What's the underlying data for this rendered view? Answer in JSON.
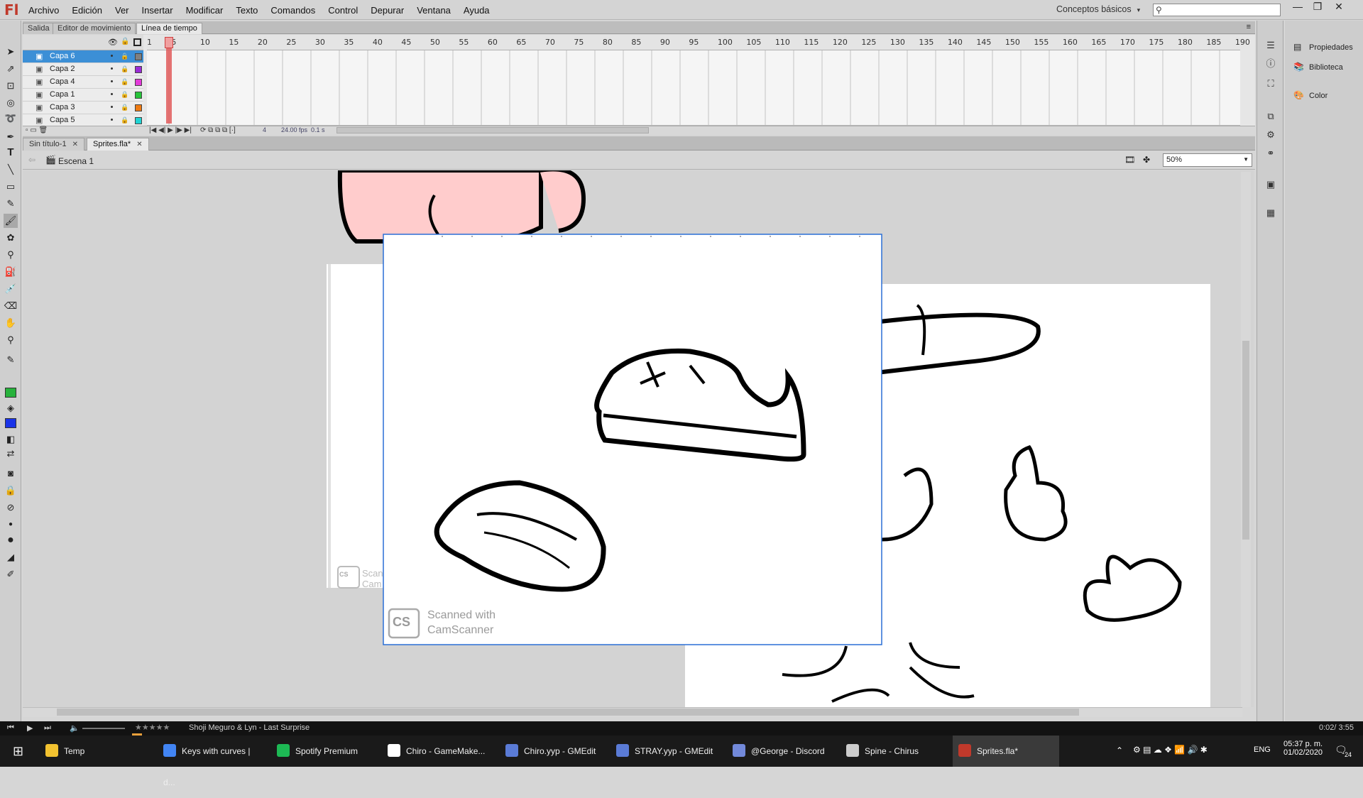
{
  "app": {
    "logo": "Fl"
  },
  "menu": [
    "Archivo",
    "Edición",
    "Ver",
    "Insertar",
    "Modificar",
    "Texto",
    "Comandos",
    "Control",
    "Depurar",
    "Ventana",
    "Ayuda"
  ],
  "workspace": {
    "label": "Conceptos básicos",
    "arrow": "▾"
  },
  "search": {
    "placeholder": ""
  },
  "window_controls": [
    "—",
    "❐",
    "✕"
  ],
  "panel_tabs": [
    "Salida",
    "Editor de movimiento",
    "Línea de tiempo"
  ],
  "timeline": {
    "layers": [
      "Capa 6",
      "Capa 2",
      "Capa 4",
      "Capa 1",
      "Capa 3",
      "Capa 5"
    ],
    "layer_colors": [
      "#808080",
      "#9b2bd6",
      "#e23ad8",
      "#27c43a",
      "#ee7a12",
      "#20d3d3"
    ],
    "ruler_ticks": [
      "1",
      "5",
      "10",
      "15",
      "20",
      "25",
      "30",
      "35",
      "40",
      "45",
      "50",
      "55",
      "60",
      "65",
      "70",
      "75",
      "80",
      "85",
      "90",
      "95",
      "100",
      "105",
      "110",
      "115",
      "120",
      "125",
      "130",
      "135",
      "140",
      "145",
      "150",
      "155",
      "160",
      "165",
      "170",
      "175",
      "180",
      "185",
      "190"
    ],
    "current_frame": "4",
    "fps": "24.00",
    "fps_unit": "fps",
    "time": "0.1 s"
  },
  "doc_tabs": [
    "Sin título-1",
    "Sprites.fla*"
  ],
  "scene": {
    "label": "Escena 1",
    "zoom": "50%"
  },
  "stage": {
    "watermark_line1": "Scanned with",
    "watermark_line2": "CamScanner",
    "watermark_short1": "Scan",
    "watermark_short2": "Cam",
    "cs": "CS"
  },
  "right_panel": {
    "items": [
      "Propiedades",
      "Biblioteca",
      "Color"
    ]
  },
  "media": {
    "track": "Shoji Meguro & Lyn - Last Surprise",
    "time": "0:02/ 3:55"
  },
  "taskbar": {
    "items": [
      "Temp",
      "Keys with curves | d...",
      "Spotify Premium",
      "Chiro - GameMake...",
      "Chiro.yyp - GMEdit",
      "STRAY.yyp - GMEdit",
      "@George - Discord",
      "Spine - Chirus",
      "Sprites.fla*"
    ],
    "icon_colors": [
      "#f2c230",
      "#4285f4",
      "#1db954",
      "#ffffff",
      "#5a7bd6",
      "#5a7bd6",
      "#7289da",
      "#cccccc",
      "#c0392b"
    ],
    "lang": "ENG",
    "clock_time": "05:37 p. m.",
    "clock_date": "01/02/2020",
    "notif": "24"
  }
}
